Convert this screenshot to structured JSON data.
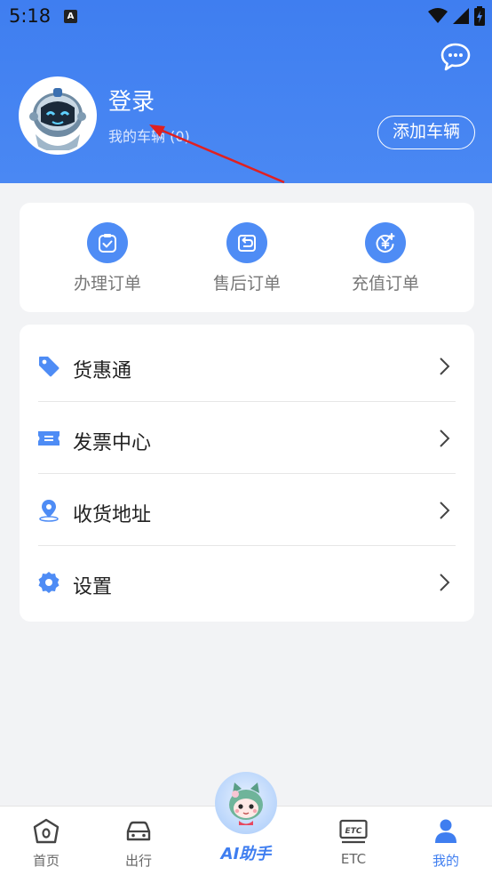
{
  "status_bar": {
    "time": "5:18",
    "notification_badge": "A"
  },
  "header": {
    "title": "登录",
    "subtitle": "我的车辆 (0)",
    "add_vehicle_label": "添加车辆",
    "icons": [
      "chat-bubble-icon"
    ]
  },
  "orders": {
    "items": [
      {
        "label": "办理订单",
        "icon": "clipboard-check-icon"
      },
      {
        "label": "售后订单",
        "icon": "return-box-icon"
      },
      {
        "label": "充值订单",
        "icon": "yuan-coin-icon"
      }
    ]
  },
  "menu": {
    "items": [
      {
        "label": "货惠通",
        "icon": "tag-icon"
      },
      {
        "label": "发票中心",
        "icon": "ticket-icon"
      },
      {
        "label": "收货地址",
        "icon": "location-pin-icon"
      },
      {
        "label": "设置",
        "icon": "gear-icon"
      }
    ]
  },
  "tabbar": {
    "items": [
      {
        "label": "首页",
        "icon": "home-icon"
      },
      {
        "label": "出行",
        "icon": "car-icon"
      },
      {
        "label": "AI助手",
        "icon": "ai-assistant-avatar-icon"
      },
      {
        "label": "ETC",
        "icon": "etc-card-icon"
      },
      {
        "label": "我的",
        "icon": "user-icon"
      }
    ],
    "active": "我的"
  },
  "colors": {
    "brand": "#3f7ef0",
    "icon_blue": "#4e8cf5",
    "background": "#f2f3f5"
  }
}
